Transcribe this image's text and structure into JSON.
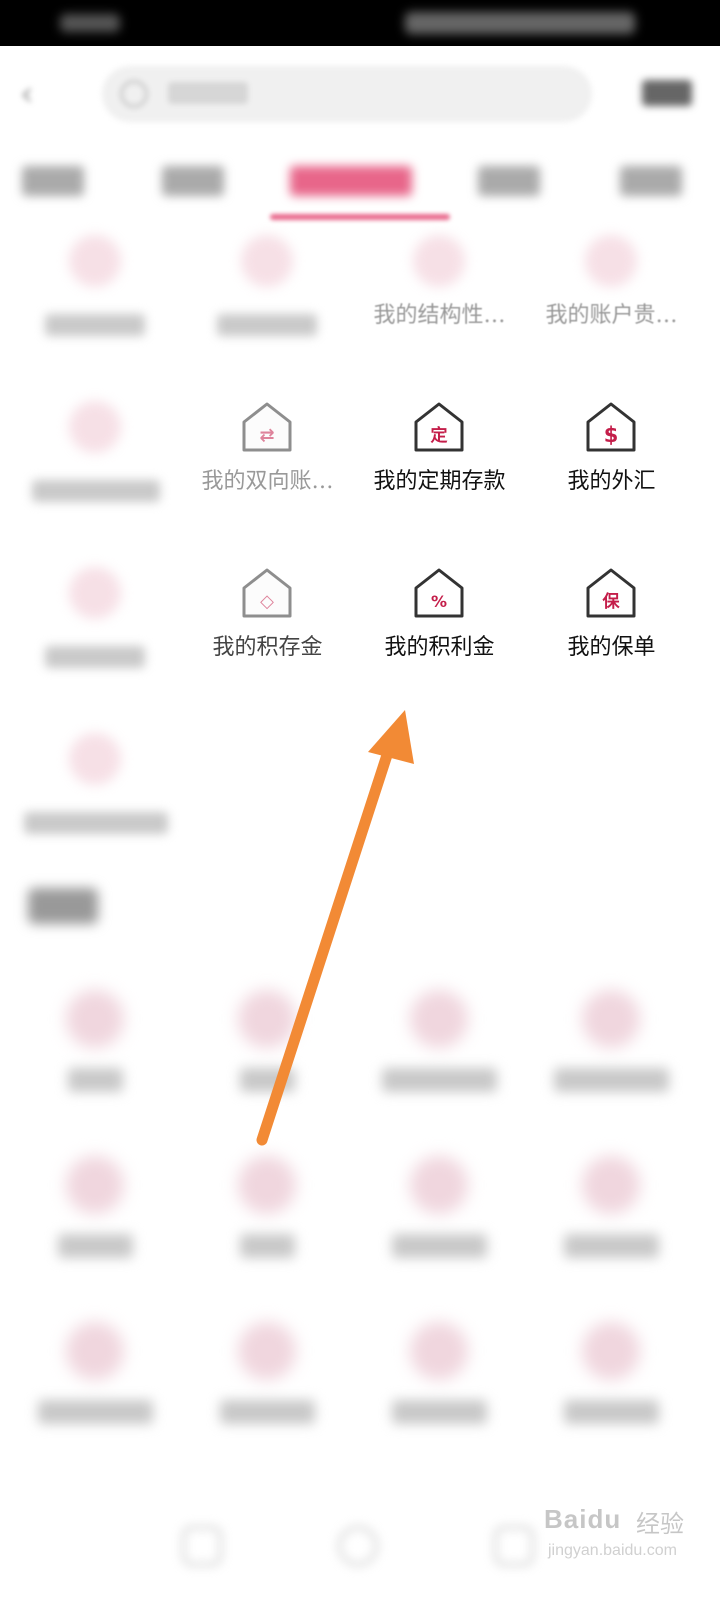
{
  "grid": {
    "row1": [
      {
        "label": "",
        "icon": "blurred-icon"
      },
      {
        "label": "",
        "icon": "blurred-icon"
      },
      {
        "label": "我的结构性…",
        "icon": "blurred-icon"
      },
      {
        "label": "我的账户贵…",
        "icon": "blurred-icon"
      }
    ],
    "row2": [
      {
        "label": "",
        "icon": "blurred-icon"
      },
      {
        "label": "我的双向账…",
        "icon": "exchange-house-icon",
        "glyph": "⇄"
      },
      {
        "label": "我的定期存款",
        "icon": "time-deposit-house-icon",
        "glyph": "定"
      },
      {
        "label": "我的外汇",
        "icon": "forex-house-icon",
        "glyph": "$"
      }
    ],
    "row3": [
      {
        "label": "",
        "icon": "blurred-icon"
      },
      {
        "label": "我的积存金",
        "icon": "gold-accumulation-house-icon",
        "glyph": "◇"
      },
      {
        "label": "我的积利金",
        "icon": "gold-interest-house-icon",
        "glyph": "%"
      },
      {
        "label": "我的保单",
        "icon": "insurance-policy-house-icon",
        "glyph": "保"
      }
    ]
  },
  "watermark": {
    "brand": "Baidu",
    "cn": "经验",
    "url": "jingyan.baidu.com"
  },
  "colors": {
    "accent": "#c41e4a",
    "icon_stroke": "#333333",
    "arrow": "#f28a35"
  }
}
